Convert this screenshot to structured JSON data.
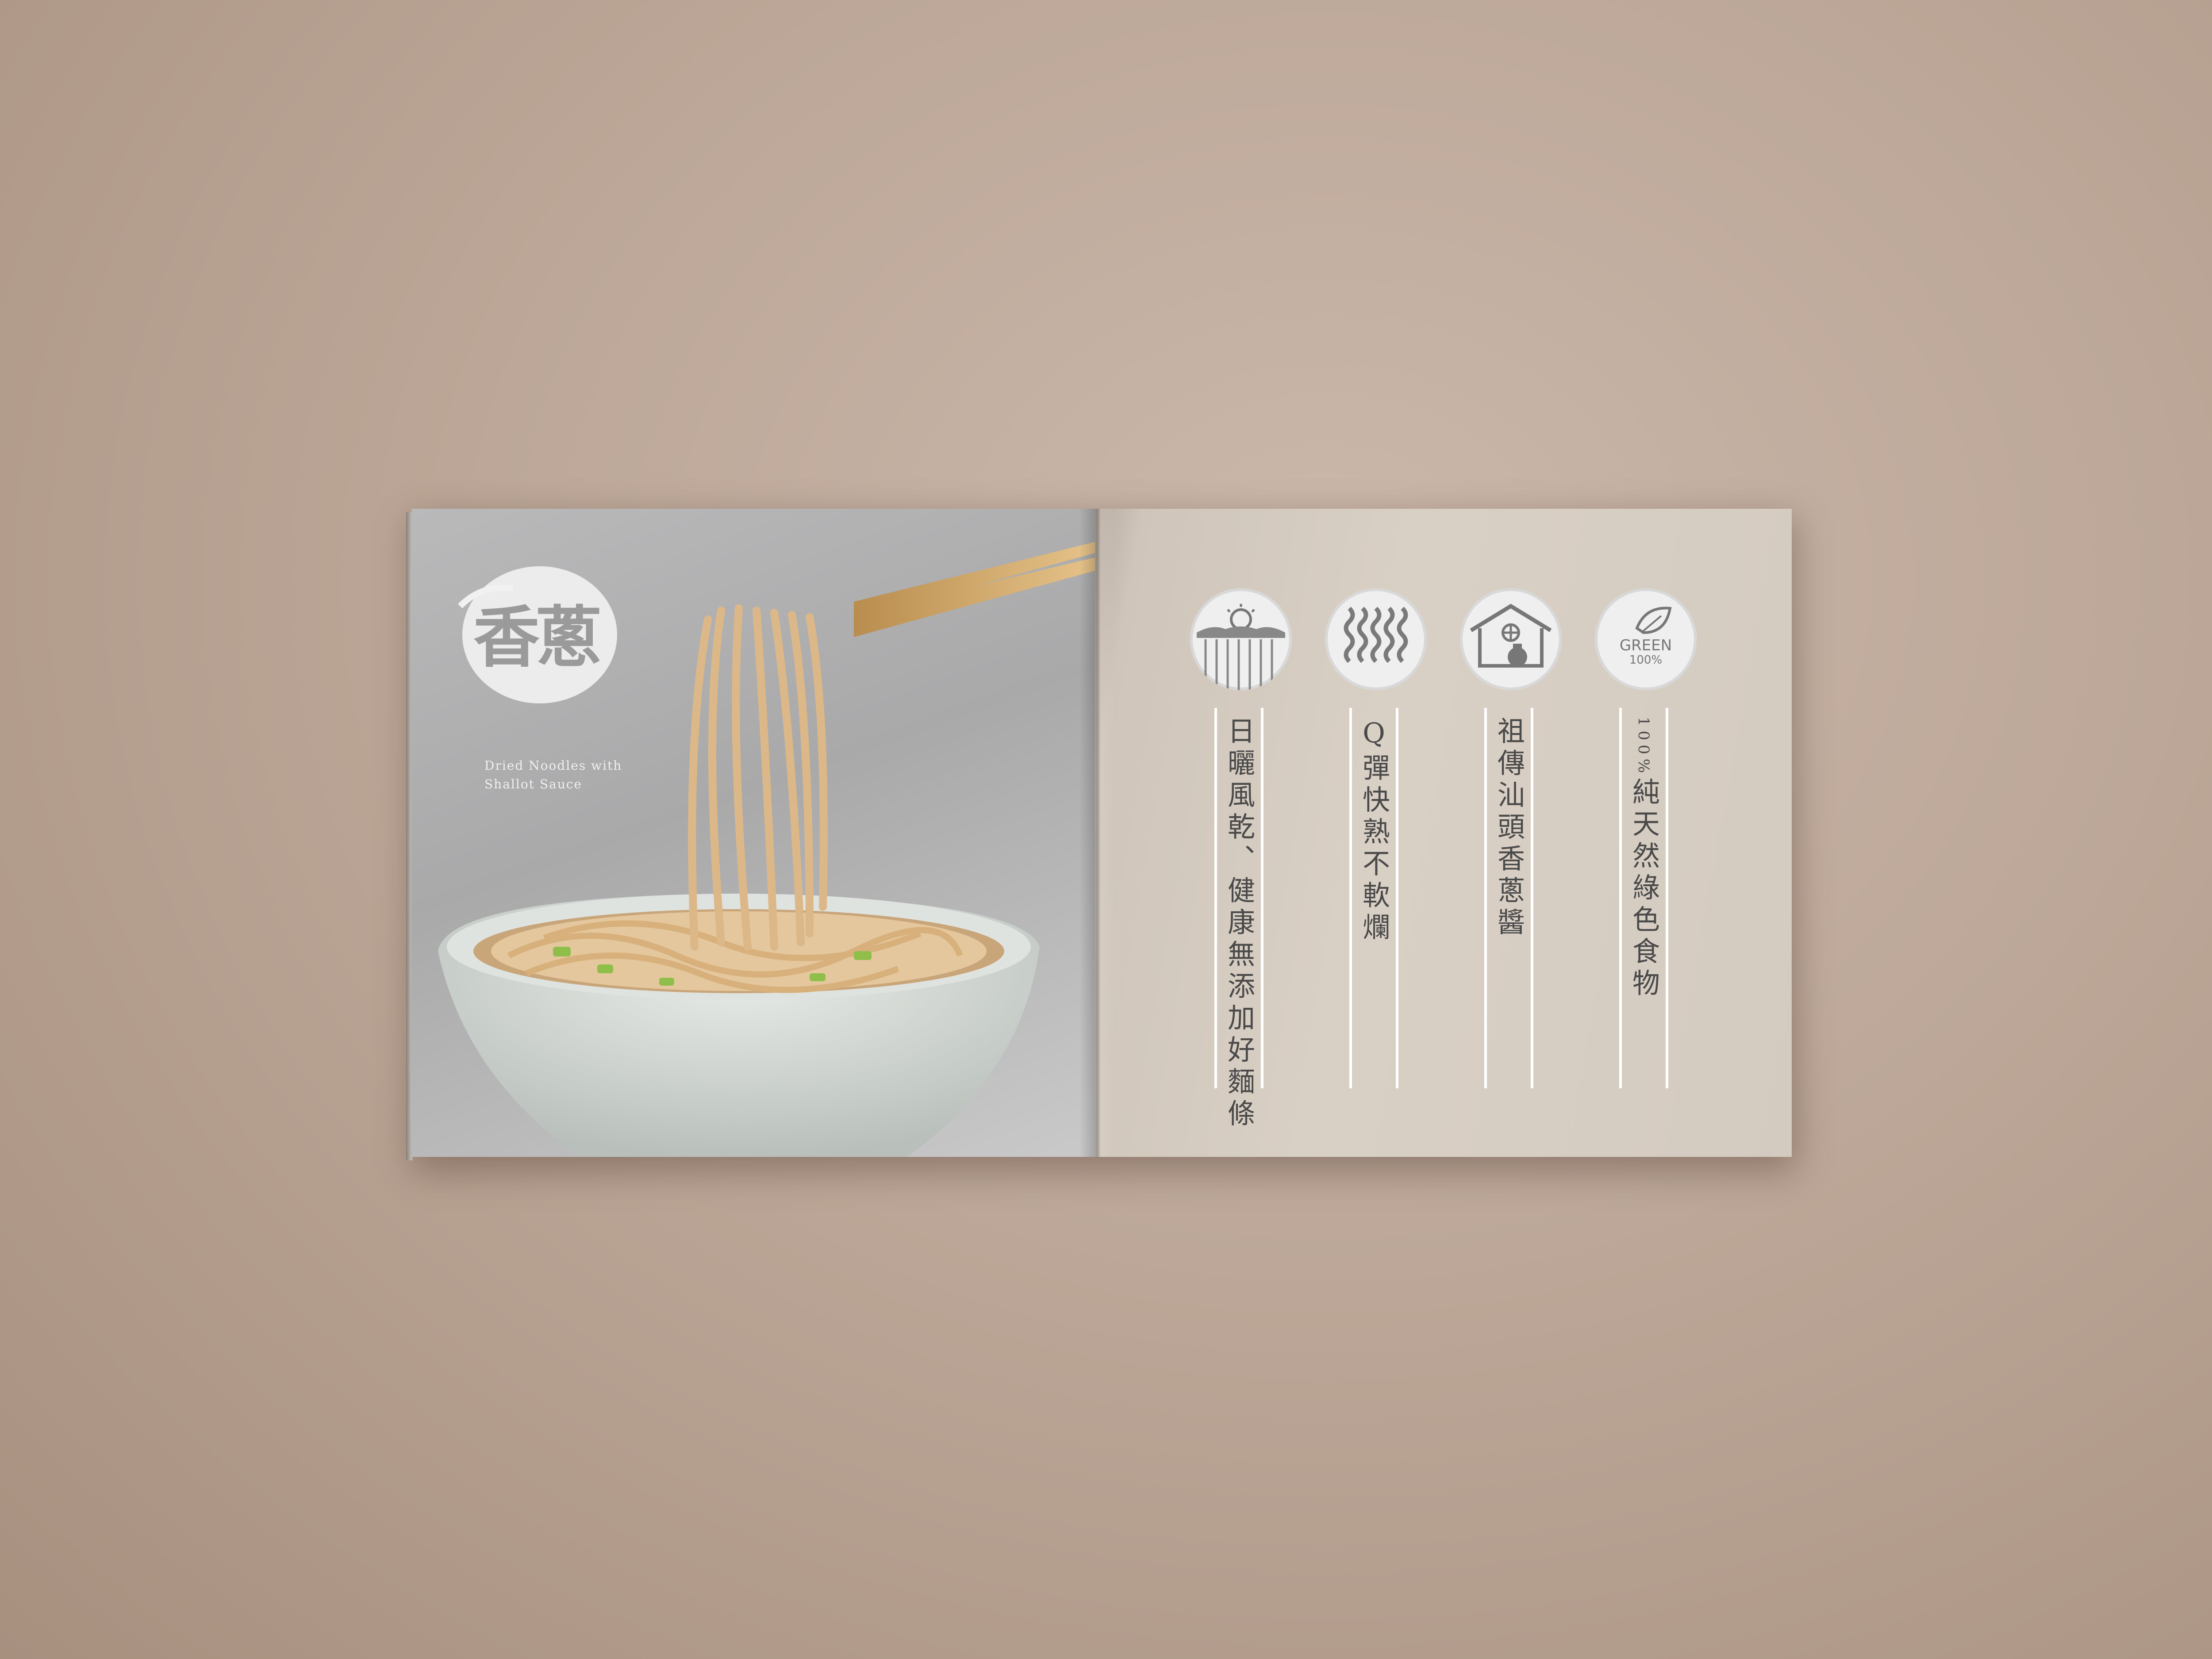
{
  "brochure": {
    "logo_title": "香蔥",
    "logo_subtitle_line1": "Dried Noodles with",
    "logo_subtitle_line2": "Shallot Sauce",
    "features": [
      {
        "icon": "sun-drying-icon",
        "text": "日曬風乾、健康無添加好麵條"
      },
      {
        "icon": "wavy-noodles-icon",
        "text": "Q彈快熟不軟爛"
      },
      {
        "icon": "ancestral-house-icon",
        "text": "祖傳汕頭香蔥醬"
      },
      {
        "icon": "green-leaf-icon",
        "prefix": "100%",
        "text": "純天然綠色食物",
        "badge_line1": "GREEN",
        "badge_line2": "100%"
      }
    ]
  }
}
